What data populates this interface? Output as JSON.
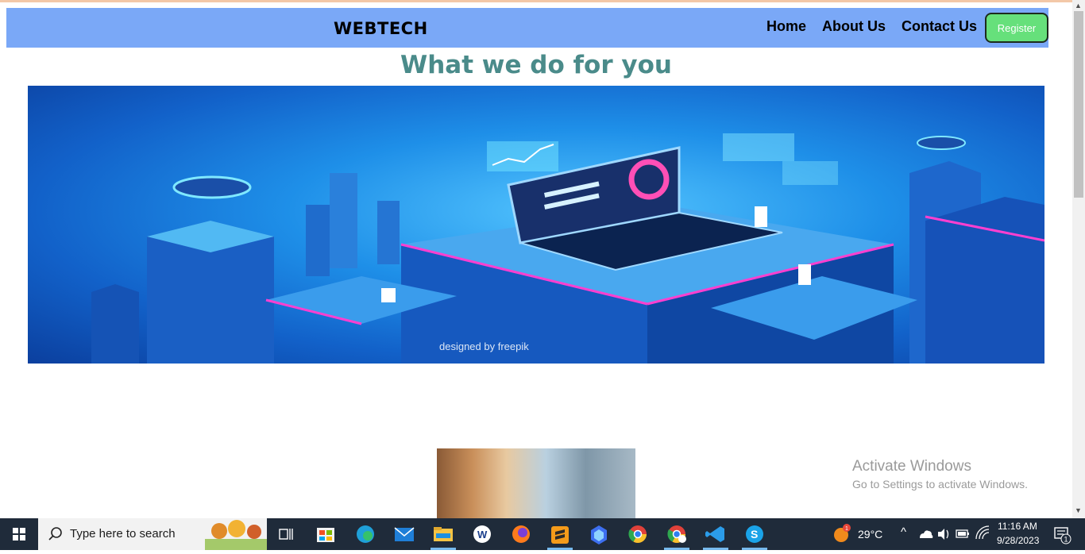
{
  "navbar": {
    "brand": "WEBTECH",
    "links": [
      "Home",
      "About Us",
      "Contact Us"
    ],
    "register_label": "Register",
    "bg_color": "#7aa8f7",
    "register_color": "#66e07b"
  },
  "main": {
    "heading": "What we do for you",
    "heading_color": "#4a8b8a",
    "hero_watermark": "designed by  freepik"
  },
  "watermark": {
    "title": "Activate Windows",
    "subtitle": "Go to Settings to activate Windows."
  },
  "taskbar": {
    "search_placeholder": "Type here to search",
    "apps": [
      "task-view",
      "microsoft-store",
      "edge",
      "mail",
      "file-explorer",
      "word-app",
      "firefox",
      "sublime-text",
      "photos-app",
      "chrome",
      "chrome-profile",
      "vs-code",
      "skype"
    ],
    "weather_temp": "29°C",
    "weather_badge": "1",
    "time": "11:16 AM",
    "date": "9/28/2023",
    "notification_count": "1"
  }
}
